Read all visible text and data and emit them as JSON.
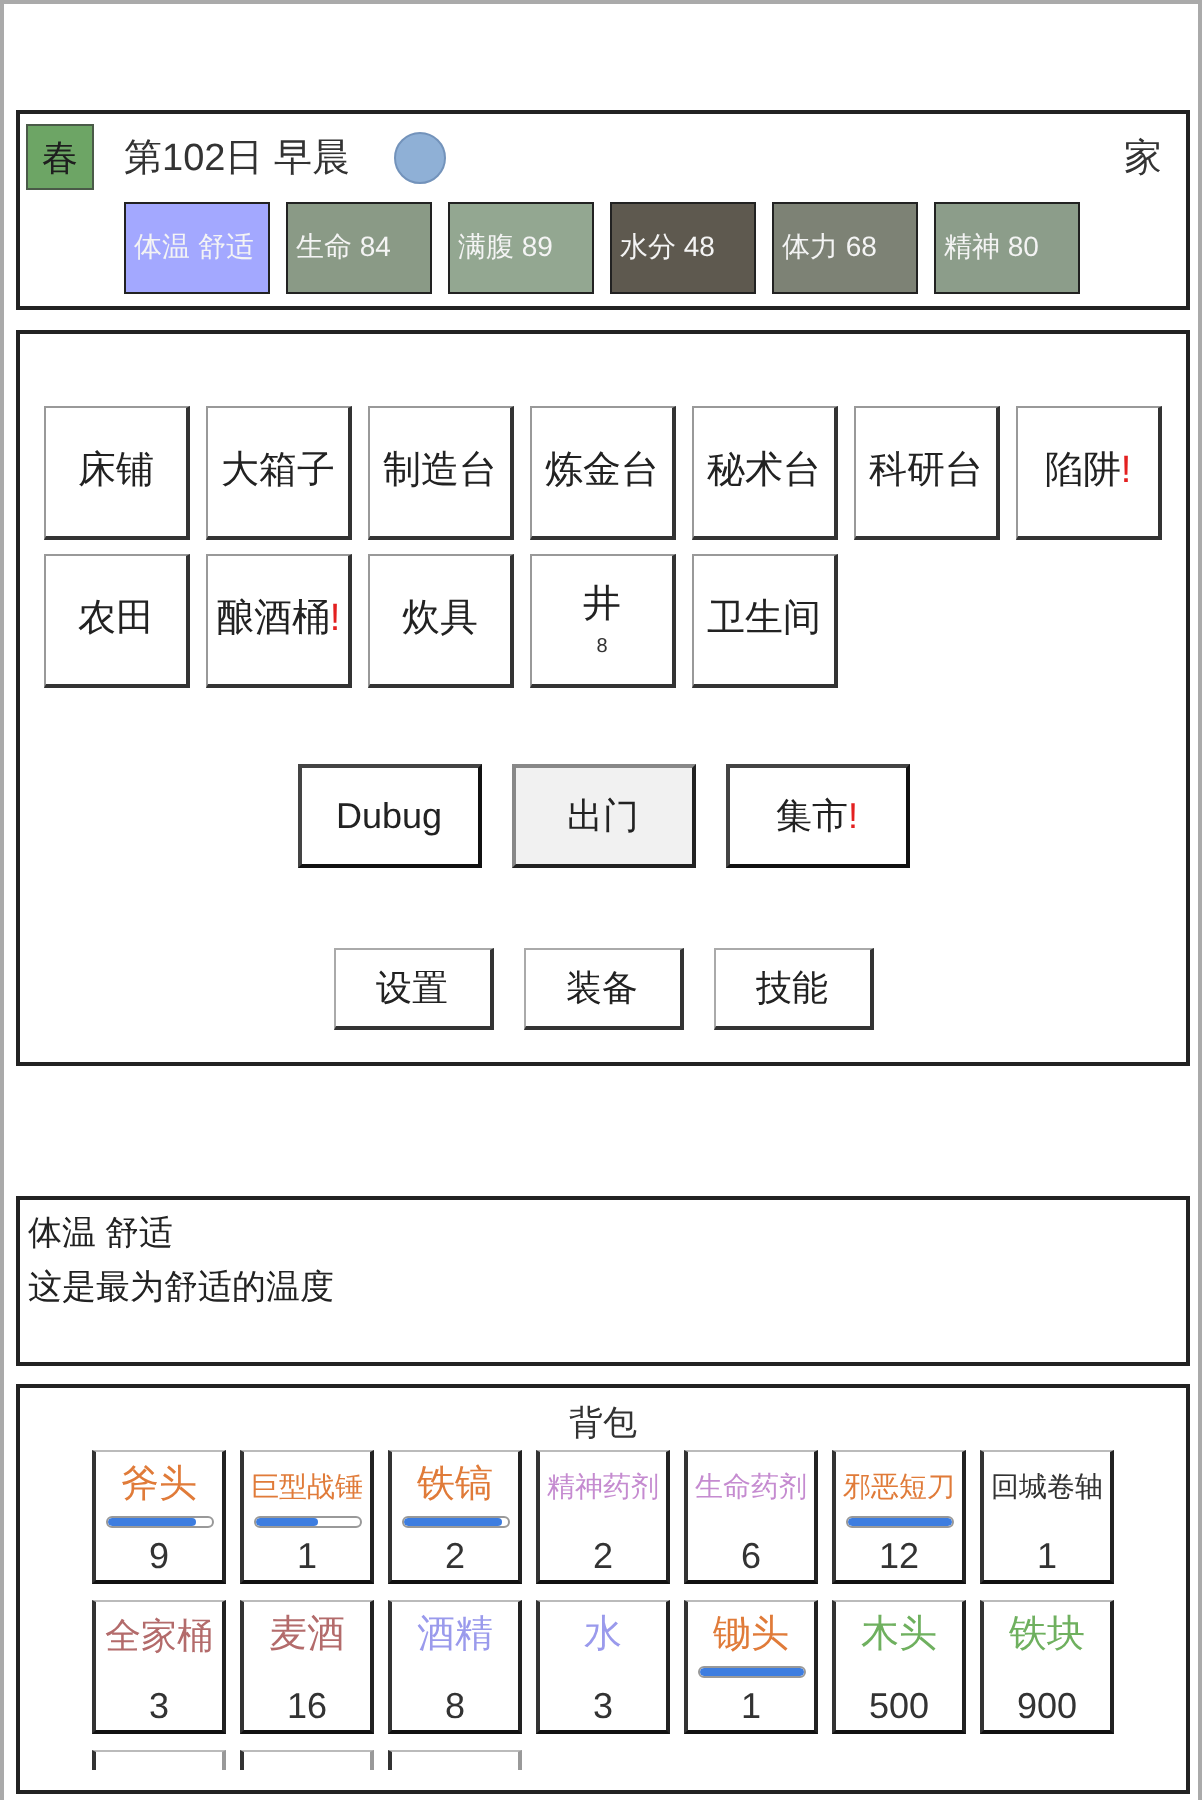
{
  "status": {
    "season": "春",
    "date": "第102日 早晨",
    "location": "家",
    "stats": [
      {
        "label": "体温 舒适",
        "color": "#a3a8ff"
      },
      {
        "label": "生命 84",
        "color": "#8a9a86"
      },
      {
        "label": "满腹 89",
        "color": "#93a791"
      },
      {
        "label": "水分 48",
        "color": "#5e594f"
      },
      {
        "label": "体力 68",
        "color": "#7d8275"
      },
      {
        "label": "精神 80",
        "color": "#8c9d8a"
      }
    ]
  },
  "buildings": [
    {
      "label": "床铺"
    },
    {
      "label": "大箱子"
    },
    {
      "label": "制造台"
    },
    {
      "label": "炼金台"
    },
    {
      "label": "秘术台"
    },
    {
      "label": "科研台"
    },
    {
      "label": "陷阱",
      "alert": "!"
    },
    {
      "label": "农田"
    },
    {
      "label": "酿酒桶",
      "alert": "!"
    },
    {
      "label": "炊具"
    },
    {
      "label": "井",
      "count": "8"
    },
    {
      "label": "卫生间"
    }
  ],
  "actions": [
    {
      "label": "Dubug",
      "selected": false
    },
    {
      "label": "出门",
      "selected": true
    },
    {
      "label": "集市",
      "alert": "!",
      "selected": false
    }
  ],
  "menu": [
    {
      "label": "设置"
    },
    {
      "label": "装备"
    },
    {
      "label": "技能"
    }
  ],
  "description": {
    "title": "体温 舒适",
    "text": "这是最为舒适的温度"
  },
  "inventory": {
    "title": "背包",
    "items": [
      {
        "name": "斧头",
        "color": "#e07b39",
        "level": 0.85,
        "count": "9"
      },
      {
        "name": "巨型战锤",
        "color": "#e07b39",
        "level": 0.6,
        "count": "1"
      },
      {
        "name": "铁镐",
        "color": "#e07b39",
        "level": 0.95,
        "count": "2"
      },
      {
        "name": "精神药剂",
        "color": "#c58bd0",
        "count": "2"
      },
      {
        "name": "生命药剂",
        "color": "#c58bd0",
        "count": "6"
      },
      {
        "name": "邪恶短刀",
        "color": "#e07b39",
        "level": 1,
        "count": "12"
      },
      {
        "name": "回城卷轴",
        "color": "#333333",
        "count": "1"
      },
      {
        "name": "全家桶",
        "color": "#b36b6b",
        "count": "3"
      },
      {
        "name": "麦酒",
        "color": "#b36b6b",
        "count": "16"
      },
      {
        "name": "酒精",
        "color": "#9a9aec",
        "count": "8"
      },
      {
        "name": "水",
        "color": "#9a9aec",
        "count": "3"
      },
      {
        "name": "锄头",
        "color": "#e07b39",
        "level": 1,
        "count": "1"
      },
      {
        "name": "木头",
        "color": "#6fb05f",
        "count": "500"
      },
      {
        "name": "铁块",
        "color": "#6fb05f",
        "count": "900"
      }
    ],
    "clipped_slots": [
      {
        "kind": "slot"
      },
      {
        "kind": "slot"
      },
      {
        "kind": "slot"
      }
    ]
  }
}
